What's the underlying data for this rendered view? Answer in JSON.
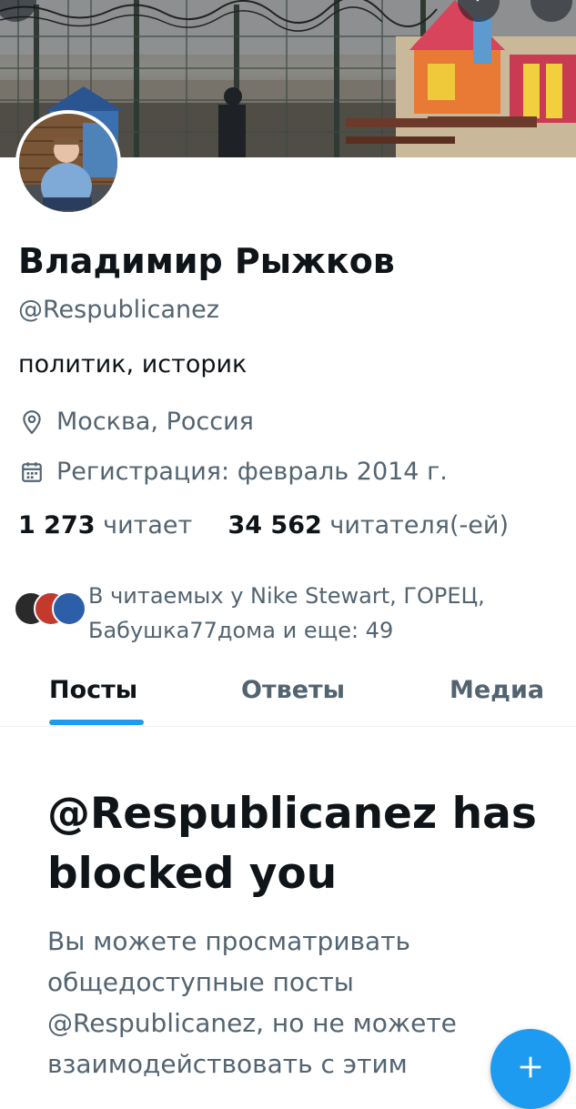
{
  "header": {
    "back_icon": "arrow-left-icon",
    "search_icon": "search-icon",
    "more_icon": "more-vertical-icon"
  },
  "profile": {
    "name": "Владимир Рыжков",
    "handle": "@Respublicanez",
    "bio": "политик, историк",
    "location": "Москва, Россия",
    "location_icon": "location-pin-icon",
    "joined": "Регистрация: февраль 2014 г.",
    "joined_icon": "calendar-icon",
    "following_count": "1 273",
    "following_label": "читает",
    "followers_count": "34 562",
    "followers_label": "читателя(-ей)"
  },
  "followed_by": {
    "text": "В читаемых у Nike Stewart, ГОРЕЦ, Бабушка77дома и еще: 49"
  },
  "tabs": [
    {
      "label": "Посты",
      "active": true
    },
    {
      "label": "Ответы",
      "active": false
    },
    {
      "label": "Медиа",
      "active": false
    }
  ],
  "blocked": {
    "title": "@Respublicanez has blocked you",
    "text": "Вы можете просматривать общедоступные посты @Respublicanez, но не можете взаимодействовать с этим"
  },
  "colors": {
    "accent": "#1d9bf0",
    "text_primary": "#0f1419",
    "text_secondary": "#536471"
  },
  "fab": {
    "icon": "plus-icon"
  }
}
